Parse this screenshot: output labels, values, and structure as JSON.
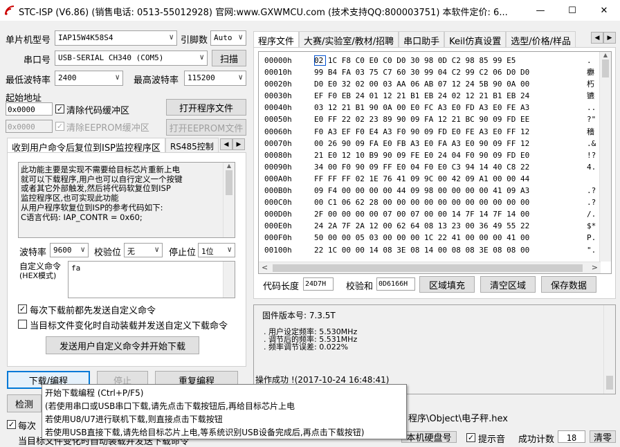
{
  "window": {
    "title": "STC-ISP (V6.86) (销售电话: 0513-55012928) 官网:www.GXWMCU.com  (技术支持QQ:800003751) 本软件定价: 6...",
    "min": "—",
    "max": "☐",
    "close": "✕"
  },
  "left": {
    "mcu_label": "单片机型号",
    "mcu_value": "IAP15W4K58S4",
    "pins_label": "引脚数",
    "pins_value": "Auto",
    "port_label": "串口号",
    "port_value": "USB-SERIAL CH340 (COM5)",
    "scan": "扫描",
    "min_baud_label": "最低波特率",
    "min_baud": "2400",
    "max_baud_label": "最高波特率",
    "max_baud": "115200",
    "start_addr_label": "起始地址",
    "addr1": "0x0000",
    "clear_code": "清除代码缓冲区",
    "open_prog": "打开程序文件",
    "addr2": "0x0000",
    "clear_eeprom": "清除EEPROM缓冲区",
    "open_eeprom": "打开EEPROM文件"
  },
  "left_tabs": {
    "tab1": "收到用户命令后复位到ISP监控程序区",
    "tab2": "RS485控制"
  },
  "info_text": [
    "此功能主要是实现不需要给目标芯片重新上电",
    "就可以下载程序,用户也可以自行定义一个按键",
    "或者其它外部触发,然后将代码软复位到ISP",
    "监控程序区,也可实现此功能",
    "",
    "从用户程序软复位到ISP的参考代码如下:",
    "C语言代码: IAP_CONTR = 0x60;"
  ],
  "serial": {
    "baud_label": "波特率",
    "baud": "9600",
    "parity_label": "校验位",
    "parity": "无",
    "stop_label": "停止位",
    "stop": "1位"
  },
  "custom": {
    "label1": "自定义命令",
    "label2": "(HEX模式)",
    "value": "fa",
    "check1": "每次下载前都先发送自定义命令",
    "check2": "当目标文件变化时自动装载并发送自定义下载命令",
    "send_btn": "发送用户自定义命令并开始下载"
  },
  "bottom_left": {
    "download": "下载/编程",
    "stop": "停止",
    "reprogram": "重复编程",
    "detect": "检测",
    "every_time": "每次",
    "auto_load": "当目标文件变化时自动装载并发送下载命令"
  },
  "right_tabs": [
    "程序文件",
    "大赛/实验室/教材/招聘",
    "串口助手",
    "Keil仿真设置",
    "选型/价格/样品"
  ],
  "hex_rows": [
    {
      "addr": "00000h",
      "bytes": "02 1C F8 C0 E0 C0 D0 30 98 0D C2 98 85 99 E5",
      "ascii": "."
    },
    {
      "addr": "00010h",
      "bytes": "99 B4 FA 03 75 C7 60 30 99 04 C2 99 C2 06 D0 D0",
      "ascii": "欁"
    },
    {
      "addr": "00020h",
      "bytes": "D0 E0 32 02 00 03 AA 06 AB 07 12 24 5B 90 0A 00",
      "ascii": "朽"
    },
    {
      "addr": "00030h",
      "bytes": "EF F0 EB 24 01 12 21 B1 EB 24 02 12 21 B1 EB 24",
      "ascii": "镳"
    },
    {
      "addr": "00040h",
      "bytes": "03 12 21 B1 90 0A 00 E0 FC A3 E0 FD A3 E0 FE A3",
      "ascii": ".."
    },
    {
      "addr": "00050h",
      "bytes": "E0 FF 22 02 23 89 90 09 FA 12 21 BC 90 09 FD EE",
      "ascii": "?\""
    },
    {
      "addr": "00060h",
      "bytes": "F0 A3 EF F0 E4 A3 F0 90 09 FD E0 FE A3 E0 FF 12",
      "ascii": "穡"
    },
    {
      "addr": "00070h",
      "bytes": "00 26 90 09 FA E0 FB A3 E0 FA A3 E0 90 09 FF 12",
      "ascii": ".&"
    },
    {
      "addr": "00080h",
      "bytes": "21 E0 12 10 B9 90 09 FE E0 24 04 F0 90 09 FD E0",
      "ascii": "!?"
    },
    {
      "addr": "00090h",
      "bytes": "34 00 F0 90 09 FF E0 04 F0 E0 C3 94 14 40 C8 22",
      "ascii": "4."
    },
    {
      "addr": "000A0h",
      "bytes": "FF FF FF 02 1E 76 41 09 9C 00 42 09 A1 00 00 44",
      "ascii": ""
    },
    {
      "addr": "000B0h",
      "bytes": "09 F4 00 00 00 00 44 09 98 00 00 00 00 41 09 A3",
      "ascii": ".?"
    },
    {
      "addr": "000C0h",
      "bytes": "00 C1 06 62 28 00 00 00 00 00 00 00 00 00 00 00",
      "ascii": ".?"
    },
    {
      "addr": "000D0h",
      "bytes": "2F 00 00 00 00 07 00 07 00 00 14 7F 14 7F 14 00",
      "ascii": "/."
    },
    {
      "addr": "000E0h",
      "bytes": "24 2A 7F 2A 12 00 62 64 08 13 23 00 36 49 55 22",
      "ascii": "$*"
    },
    {
      "addr": "000F0h",
      "bytes": "50 00 00 05 03 00 00 00 1C 22 41 00 00 00 41 00",
      "ascii": "P."
    },
    {
      "addr": "00100h",
      "bytes": "22 1C 00 00 14 08 3E 08 14 00 08 08 3E 08 08 00",
      "ascii": "\"."
    }
  ],
  "code_bar": {
    "len_label": "代码长度",
    "len_value": "24D7H",
    "checksum_label": "校验和",
    "checksum_value": "0D6166H",
    "fill": "区域填充",
    "clear": "清空区域",
    "save": "保存数据"
  },
  "log": {
    "line1": "固件版本号: 7.3.5T",
    "line2": ". 用户设定频率: 5.530MHz",
    "line3": ". 调节后的频率: 5.531MHz",
    "line4": ". 频率调节误差: 0.022%",
    "line5": "操作成功 !(2017-10-24 16:48:41)"
  },
  "bottom_right": {
    "path": "程序\\Object\\电子秤.hex",
    "usb_disk": "本机硬盘号",
    "beep": "提示音",
    "success_label": "成功计数",
    "success_count": "18",
    "clear": "清零"
  },
  "tooltip": {
    "line1": "开始下载编程 (Ctrl+P/F5)",
    "line2": "(若使用串口或USB串口下载,请先点击下载按钮后,再给目标芯片上电",
    "line3": " 若使用U8/U7进行联机下载,则直接点击下载按钮",
    "line4": " 若使用USB直接下载,请先给目标芯片上电,等系统识别USB设备完成后,再点击下载按钮)"
  }
}
